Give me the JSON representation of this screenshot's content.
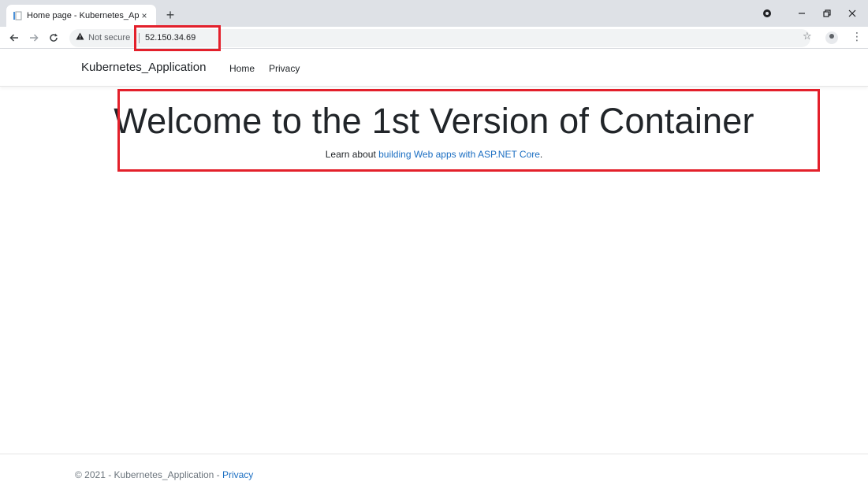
{
  "browser": {
    "tab_title": "Home page - Kubernetes_Applic",
    "tab_close": "×",
    "new_tab": "+",
    "security_label": "Not secure",
    "url": "52.150.34.69",
    "icons": {
      "favicon": "page-favicon-icon",
      "back": "arrow-left-icon",
      "forward": "arrow-right-icon",
      "reload": "reload-icon",
      "security": "warning-triangle-icon",
      "bookmark": "star-icon",
      "profile": "profile-icon",
      "menu": "kebab-menu-icon"
    }
  },
  "site": {
    "brand": "Kubernetes_Application",
    "nav": [
      "Home",
      "Privacy"
    ]
  },
  "main": {
    "heading": "Welcome to the 1st Version of Container",
    "learn_prefix": "Learn about",
    "learn_link": "building Web apps with ASP.NET Core",
    "learn_suffix": "."
  },
  "footer": {
    "text": "© 2021 - Kubernetes_Application - ",
    "link": "Privacy"
  },
  "colors": {
    "highlight_box": "#e3202b",
    "link": "#1b6ec2",
    "chrome_bg": "#dee1e6"
  }
}
